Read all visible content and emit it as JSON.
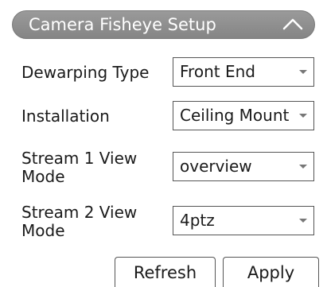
{
  "panel": {
    "title": "Camera Fisheye Setup"
  },
  "rows": [
    {
      "label": "Dewarping Type",
      "value": "Front End"
    },
    {
      "label": "Installation",
      "value": "Ceiling Mount"
    },
    {
      "label": "Stream 1 View Mode",
      "value": "overview"
    },
    {
      "label": "Stream 2 View Mode",
      "value": "4ptz"
    }
  ],
  "buttons": {
    "refresh": "Refresh",
    "apply": "Apply"
  },
  "colors": {
    "header_bg": "#8e8e8e",
    "header_text": "#ffffff",
    "arrow": "#777777"
  },
  "icons": {
    "collapse": "chevron-up-icon",
    "dropdown": "caret-down-icon"
  }
}
